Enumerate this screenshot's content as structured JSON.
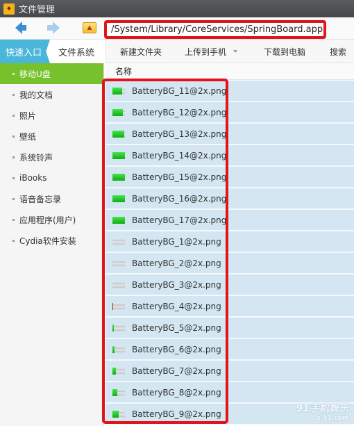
{
  "window": {
    "title": "文件管理",
    "logo_icon": "butterfly-logo-icon"
  },
  "navbar": {
    "back_icon": "arrow-left-icon",
    "forward_icon": "arrow-right-icon",
    "up_icon": "folder-up-icon",
    "path": "/System/Library/CoreServices/SpringBoard.app"
  },
  "tabs": {
    "quick": "快速入口",
    "filesystem": "文件系统"
  },
  "toolbar": {
    "new_folder": "新建文件夹",
    "upload": "上传到手机",
    "download": "下载到电脑",
    "search": "搜索"
  },
  "sidebar": {
    "items": [
      {
        "label": "移动U盘",
        "active": true
      },
      {
        "label": "我的文档",
        "active": false
      },
      {
        "label": "照片",
        "active": false
      },
      {
        "label": "壁纸",
        "active": false
      },
      {
        "label": "系统铃声",
        "active": false
      },
      {
        "label": "iBooks",
        "active": false
      },
      {
        "label": "语音备忘录",
        "active": false
      },
      {
        "label": "应用程序(用户)",
        "active": false
      },
      {
        "label": "Cydia软件安装",
        "active": false
      }
    ]
  },
  "file_list": {
    "column_name": "名称",
    "files": [
      {
        "name": "BatteryBG_11@2x.png",
        "charge": 0.8,
        "color": "green"
      },
      {
        "name": "BatteryBG_12@2x.png",
        "charge": 0.85,
        "color": "green"
      },
      {
        "name": "BatteryBG_13@2x.png",
        "charge": 0.92,
        "color": "green"
      },
      {
        "name": "BatteryBG_14@2x.png",
        "charge": 1.0,
        "color": "green"
      },
      {
        "name": "BatteryBG_15@2x.png",
        "charge": 1.0,
        "color": "green"
      },
      {
        "name": "BatteryBG_16@2x.png",
        "charge": 1.0,
        "color": "green"
      },
      {
        "name": "BatteryBG_17@2x.png",
        "charge": 1.0,
        "color": "green"
      },
      {
        "name": "BatteryBG_1@2x.png",
        "charge": 0.0,
        "color": "none"
      },
      {
        "name": "BatteryBG_2@2x.png",
        "charge": 0.0,
        "color": "none"
      },
      {
        "name": "BatteryBG_3@2x.png",
        "charge": 0.0,
        "color": "none"
      },
      {
        "name": "BatteryBG_4@2x.png",
        "charge": 0.08,
        "color": "red"
      },
      {
        "name": "BatteryBG_5@2x.png",
        "charge": 0.12,
        "color": "green"
      },
      {
        "name": "BatteryBG_6@2x.png",
        "charge": 0.18,
        "color": "green"
      },
      {
        "name": "BatteryBG_7@2x.png",
        "charge": 0.3,
        "color": "green"
      },
      {
        "name": "BatteryBG_8@2x.png",
        "charge": 0.4,
        "color": "green"
      },
      {
        "name": "BatteryBG_9@2x.png",
        "charge": 0.5,
        "color": "green"
      }
    ]
  },
  "watermark": {
    "text": "91手机娱乐",
    "sub": "s.91.com"
  }
}
